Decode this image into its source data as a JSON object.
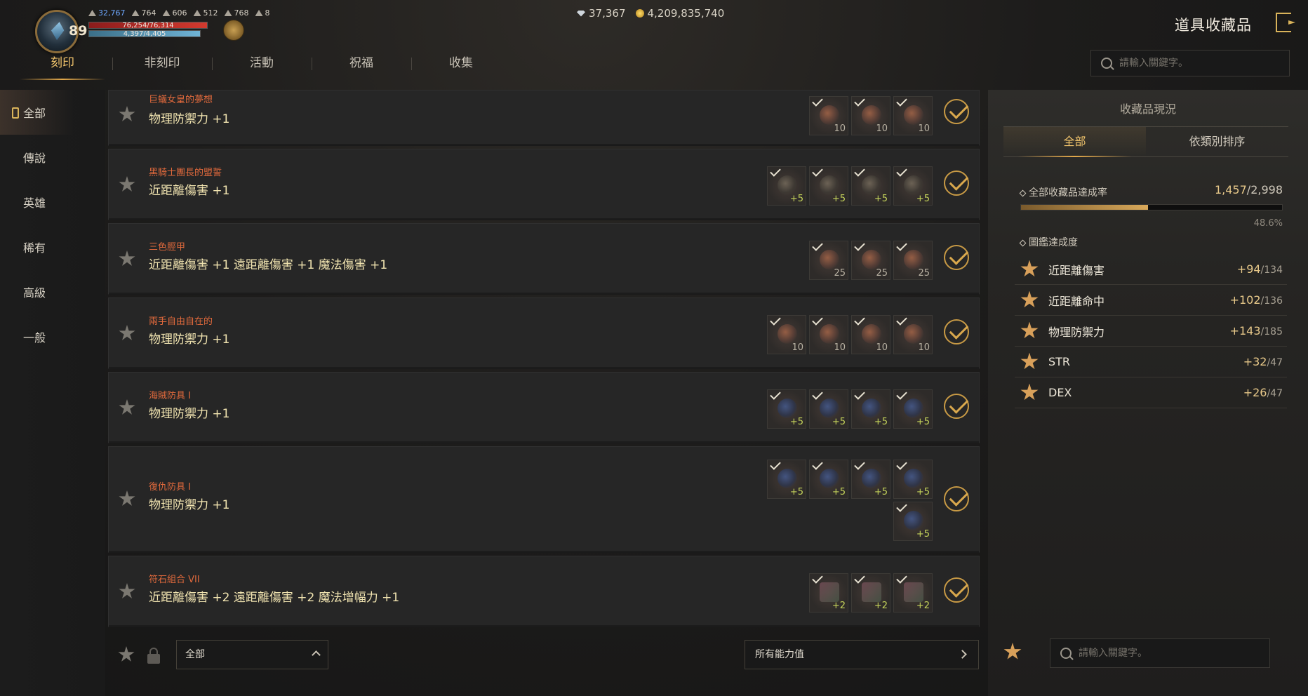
{
  "hud": {
    "level": "89",
    "stats": [
      "32,767",
      "764",
      "606",
      "512",
      "768",
      "8"
    ],
    "hp_text": "76,254/76,314",
    "mp_text": "4,397/4,405",
    "gems": "37,367",
    "gold": "4,209,835,740"
  },
  "window_title": "道具收藏品",
  "tabs": [
    "刻印",
    "非刻印",
    "活動",
    "祝福",
    "收集"
  ],
  "search_placeholder": "請輸入關鍵字。",
  "categories": [
    "全部",
    "傳說",
    "英雄",
    "稀有",
    "高級",
    "一般"
  ],
  "items": [
    {
      "title": "巨蟻女皇的夢想",
      "effect": "物理防禦力 +1",
      "slots": [
        {
          "count": "10"
        },
        {
          "count": "10"
        },
        {
          "count": "10"
        }
      ]
    },
    {
      "title": "黑騎士團長的盟誓",
      "effect": "近距離傷害 +1",
      "slots": [
        {
          "count": "+5"
        },
        {
          "count": "+5"
        },
        {
          "count": "+5"
        },
        {
          "count": "+5"
        }
      ]
    },
    {
      "title": "三色脛甲",
      "effect": "近距離傷害 +1 遠距離傷害 +1 魔法傷害 +1",
      "slots": [
        {
          "count": "25"
        },
        {
          "count": "25"
        },
        {
          "count": "25"
        }
      ]
    },
    {
      "title": "兩手自由自在的",
      "effect": "物理防禦力 +1",
      "slots": [
        {
          "count": "10"
        },
        {
          "count": "10"
        },
        {
          "count": "10"
        },
        {
          "count": "10"
        }
      ]
    },
    {
      "title": "海賊防具 I",
      "effect": "物理防禦力 +1",
      "slots": [
        {
          "count": "+5"
        },
        {
          "count": "+5"
        },
        {
          "count": "+5"
        },
        {
          "count": "+5"
        }
      ]
    },
    {
      "title": "復仇防具 I",
      "effect": "物理防禦力 +1",
      "slots": [
        {
          "count": "+5"
        },
        {
          "count": "+5"
        },
        {
          "count": "+5"
        },
        {
          "count": "+5"
        },
        {
          "count": "+5"
        }
      ]
    },
    {
      "title": "符石組合 VII",
      "effect": "近距離傷害 +2 遠距離傷害 +2 魔法增幅力 +1",
      "slots": [
        {
          "count": "+2"
        },
        {
          "count": "+2"
        },
        {
          "count": "+2"
        }
      ]
    }
  ],
  "bottom": {
    "grade_filter": "全部",
    "stat_filter": "所有能力值"
  },
  "status": {
    "title": "收藏品現況",
    "tabs": [
      "全部",
      "依類別排序"
    ],
    "rate_label": "全部收藏品達成率",
    "rate_done": "1,457",
    "rate_total": "/2,998",
    "progress": 0.486,
    "rate_pct": "48.6%",
    "codex_label": "圖鑑達成度",
    "codex": [
      {
        "name": "近距離傷害",
        "value": "+94",
        "total": "/134"
      },
      {
        "name": "近距離命中",
        "value": "+102",
        "total": "/136"
      },
      {
        "name": "物理防禦力",
        "value": "+143",
        "total": "/185"
      },
      {
        "name": "STR",
        "value": "+32",
        "total": "/47"
      },
      {
        "name": "DEX",
        "value": "+26",
        "total": "/47"
      }
    ]
  }
}
